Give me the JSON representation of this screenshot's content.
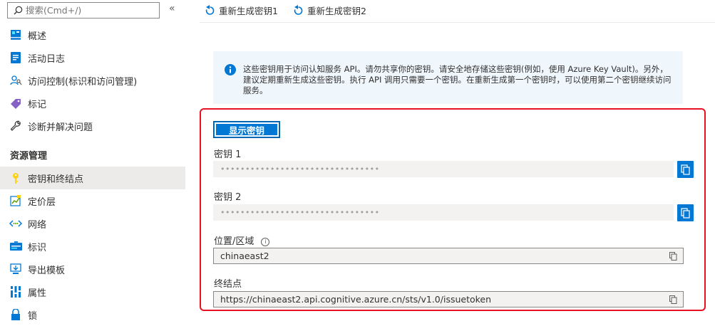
{
  "sidebar": {
    "search_placeholder": "搜索(Cmd+/)",
    "collapse_glyph": "«",
    "items_top": [
      {
        "label": "概述",
        "icon": "overview-icon"
      },
      {
        "label": "活动日志",
        "icon": "activity-log-icon"
      },
      {
        "label": "访问控制(标识和访问管理)",
        "icon": "access-control-icon"
      },
      {
        "label": "标记",
        "icon": "tag-icon"
      },
      {
        "label": "诊断并解决问题",
        "icon": "wrench-icon"
      }
    ],
    "section_title": "资源管理",
    "items_section": [
      {
        "label": "密钥和终结点",
        "icon": "key-icon",
        "selected": true
      },
      {
        "label": "定价层",
        "icon": "pricing-tier-icon"
      },
      {
        "label": "网络",
        "icon": "network-icon"
      },
      {
        "label": "标识",
        "icon": "identity-icon"
      },
      {
        "label": "导出模板",
        "icon": "export-template-icon"
      },
      {
        "label": "属性",
        "icon": "properties-icon"
      },
      {
        "label": "锁",
        "icon": "lock-icon"
      }
    ]
  },
  "toolbar": {
    "regen1": "重新生成密钥1",
    "regen2": "重新生成密钥2"
  },
  "info": {
    "text": "这些密钥用于访问认知服务 API。请勿共享你的密钥。请安全地存储这些密钥(例如，使用 Azure Key Vault)。另外，建议定期重新生成这些密钥。执行 API 调用只需要一个密钥。在重新生成第一个密钥时，可以使用第二个密钥继续访问服务。"
  },
  "keys": {
    "show_button": "显示密钥",
    "key1_label": "密钥 1",
    "key1_value": "••••••••••••••••••••••••••••••••",
    "key2_label": "密钥 2",
    "key2_value": "••••••••••••••••••••••••••••••••",
    "location_label": "位置/区域",
    "location_value": "chinaeast2",
    "endpoint_label": "终结点",
    "endpoint_value": "https://chinaeast2.api.cognitive.azure.cn/sts/v1.0/issuetoken"
  },
  "colors": {
    "accent": "#0078d4",
    "highlight_border": "#e81123"
  }
}
